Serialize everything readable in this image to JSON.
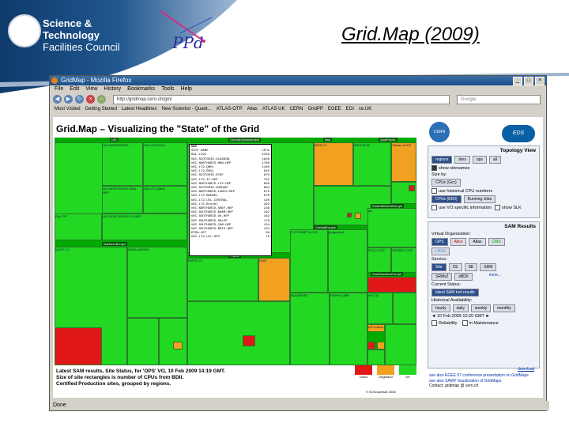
{
  "slide": {
    "org_line1": "Science & Technology",
    "org_line2": "Facilities Council",
    "ppd": "PPd",
    "title": "Grid.Map (2009)"
  },
  "browser": {
    "window_title": "GridMap - Mozilla Firefox",
    "menu": [
      "File",
      "Edit",
      "View",
      "History",
      "Bookmarks",
      "Tools",
      "Help"
    ],
    "url": "http://gridmap.cern.ch/gm/",
    "search_placeholder": "Google",
    "bookmarks": [
      "Most Visited",
      "Getting Started",
      "Latest Headlines",
      "New Scientist - Quant...",
      "ATLAS-OTP",
      "Atlas",
      "ATLAS UK",
      "CERN",
      "GridPP",
      "EGEE",
      "EGI",
      "ce.UK"
    ],
    "status": "Done"
  },
  "gridmap": {
    "title": "Grid.Map – Visualizing the \"State\" of the Grid",
    "regions": [
      "UKI",
      "GermanySwitzerland",
      "Italy",
      "AsiaPacific",
      "NorthernEurope",
      "SouthWesternEurope",
      "CentralEurope",
      "France",
      "SouthEasternEurope",
      "CERN"
    ],
    "tiles": {
      "ukinorth": "UKI-NORTHGRID-...",
      "ukilt2": "UKI-LT2-RHUL",
      "ralpp": "RAL-PP",
      "ukiscot": "UKI-SCOTGRID-GLASGOW",
      "ukiman": "UKI-NORTHGRID-MAN-HEP",
      "ukilt2qmul": "UKI-LT2-QMUL",
      "ukisouth": "UKI-SOUTHGRID-OX-HEP",
      "fzk": "FZK-LCG2",
      "infnt1": "INFN-T1",
      "infnpisa": "INFN-PISA",
      "taiwan": "Taiwan-LCG2",
      "ndgf": "NDGF-T1",
      "sara": "SARA-MATRIX",
      "pic": "pic",
      "in2p3": "IN2P3-CC",
      "grif": "GRIF",
      "cern": "CERN-PROD",
      "cyfronet": "CYFRONET-LCG2",
      "budapest": "BUDAPEST",
      "hephy": "HEPHY-UIBK",
      "praguelcg": "praguelcg2",
      "ifca": "IFCA-LCG2",
      "ciemat": "CIEMAT-LCG2",
      "lip": "LIP-Lisbon",
      "hgtd": "HG-TD"
    },
    "tooltip": {
      "header": "UKI",
      "col_site": "SITE NAME",
      "col_cpus": "CPUs",
      "rows": [
        [
          "RAL-LCG2",
          "5458"
        ],
        [
          "UKI-SCOTGRID-GLASGOW",
          "1920"
        ],
        [
          "UKI-NORTHGRID-MAN-HEP",
          "1760"
        ],
        [
          "UKI-LT2-QMUL",
          "1440"
        ],
        [
          "UKI-LT2-RHUL",
          "940"
        ],
        [
          "UKI-SCOTGRID-ECDF",
          "870"
        ],
        [
          "UKI-LT2-IC-HEP",
          "752"
        ],
        [
          "UKI-NORTHGRID-LIV-HEP",
          "696"
        ],
        [
          "UKI-SCOTGRID-DURHAM",
          "694"
        ],
        [
          "UKI-NORTHGRID-LANCS-HEP",
          "676"
        ],
        [
          "UKI-LT2-BRUNEL",
          "676"
        ],
        [
          "UKI-LT2-UCL-CENTRAL",
          "420"
        ],
        [
          "UKI-LT2-Brunel",
          "292"
        ],
        [
          "UKI-NORTHGRID-SHEF-HEP",
          "236"
        ],
        [
          "UKI-SOUTHGRID-BHAM-HEP",
          "192"
        ],
        [
          "UKI-SOUTHGRID-OX-HEP",
          "182"
        ],
        [
          "UKI-SOUTHGRID-RALPP",
          "178"
        ],
        [
          "UKI-SOUTHGRID-CAM-HEP",
          "134"
        ],
        [
          "UKI-SOUTHGRID-BRIS-HEP",
          "124"
        ],
        [
          "EFDA-JET",
          "96"
        ],
        [
          "UKI-LT2-UCL-HEP",
          "76"
        ]
      ]
    },
    "caption_lines": [
      "Latest SAM results, Site Status, for 'OPS' VO, 10 Feb 2009 14:19 GMT.",
      "Size of site rectangles is number of CPUs from BDII.",
      "Certified Production sites, grouped by regions."
    ],
    "legend": [
      "Down",
      "Degraded",
      "OK"
    ],
    "legend_colors": [
      "#e01818",
      "#f2a020",
      "#22d822"
    ],
    "copyright": "© EDS/openlab 2008"
  },
  "sidebar": {
    "cern": "CERN",
    "eds": "EDS",
    "topology": {
      "title": "Topology View",
      "buttons": [
        "regions",
        "tiers",
        "ops",
        "all"
      ],
      "show_sitenames": "show sitenames",
      "size_by": "Size by:",
      "cpus_button": "CPUs (Gcc)",
      "historical": "use historical CPU numbers",
      "cpus_bdii": "CPUs (BDII)",
      "running_jobs": "Running Jobs",
      "vo_specific": "use VO specific information",
      "show_slk": "show SLK"
    },
    "sam": {
      "title": "SAM Results",
      "vo_label": "Virtual Organization:",
      "vos": [
        "OPS",
        "Alice",
        "Atlas",
        "CMS"
      ],
      "lhcb": "LHCb",
      "service_label": "Service:",
      "services": [
        "Site",
        "CE",
        "SE",
        "SRM"
      ],
      "services2": [
        "SRMv2",
        "sBDII"
      ],
      "more": "more...",
      "status_label": "Current Status:",
      "latest": "latest SAM tool results",
      "history_label": "Historical Availability:",
      "periods": [
        "hourly",
        "daily",
        "weekly",
        "monthly"
      ],
      "date": "10 Feb 2009 10:20 GMT",
      "reliability": "Reliability",
      "maintenance": "in Maintenance"
    },
    "footer": [
      "see also EGEE 07 conference presentation on GridMaps",
      "see also SAMV visualization of GridMaps",
      "Contact: gridmap @ cern.ch"
    ],
    "footer_link": "EDS/openlab",
    "footer_link2": "download"
  }
}
